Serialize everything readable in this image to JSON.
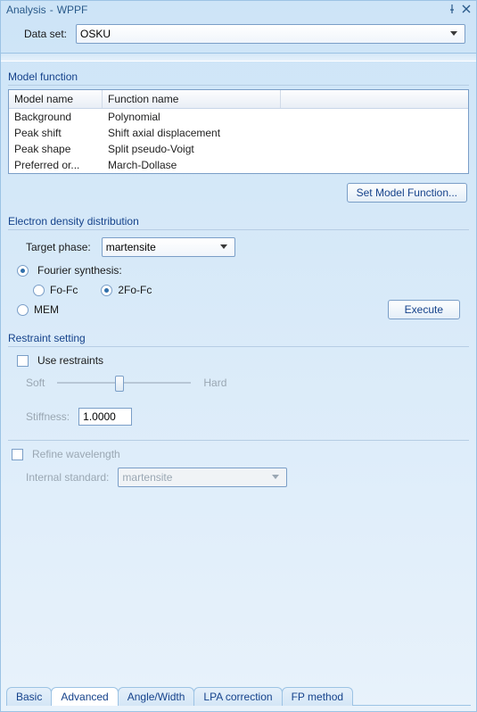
{
  "window": {
    "title_left": "Analysis",
    "title_sep": "-",
    "title_right": "WPPF"
  },
  "dataset": {
    "label": "Data set:",
    "value": "OSKU"
  },
  "model": {
    "group_title": "Model function",
    "columns": {
      "name": "Model name",
      "func": "Function name"
    },
    "rows": [
      {
        "name": "Background",
        "func": "Polynomial"
      },
      {
        "name": "Peak shift",
        "func": "Shift axial displacement"
      },
      {
        "name": "Peak shape",
        "func": "Split pseudo-Voigt"
      },
      {
        "name": "Preferred or...",
        "func": "March-Dollase"
      }
    ],
    "set_button": "Set Model Function..."
  },
  "edd": {
    "group_title": "Electron density distribution",
    "target_label": "Target phase:",
    "target_value": "martensite",
    "fourier_label": "Fourier synthesis:",
    "fourier_selected": true,
    "fo_fc_label": "Fo-Fc",
    "fo_fc_selected": false,
    "two_fo_fc_label": "2Fo-Fc",
    "two_fo_fc_selected": true,
    "mem_label": "MEM",
    "mem_selected": false,
    "execute_button": "Execute"
  },
  "restraint": {
    "group_title": "Restraint setting",
    "use_label": "Use restraints",
    "use_checked": false,
    "soft_label": "Soft",
    "hard_label": "Hard",
    "stiffness_label": "Stiffness:",
    "stiffness_value": "1.0000"
  },
  "wavelength": {
    "refine_label": "Refine wavelength",
    "refine_checked": false,
    "internal_label": "Internal standard:",
    "internal_value": "martensite"
  },
  "tabs": {
    "items": [
      "Basic",
      "Advanced",
      "Angle/Width",
      "LPA correction",
      "FP method"
    ],
    "active_index": 1
  }
}
